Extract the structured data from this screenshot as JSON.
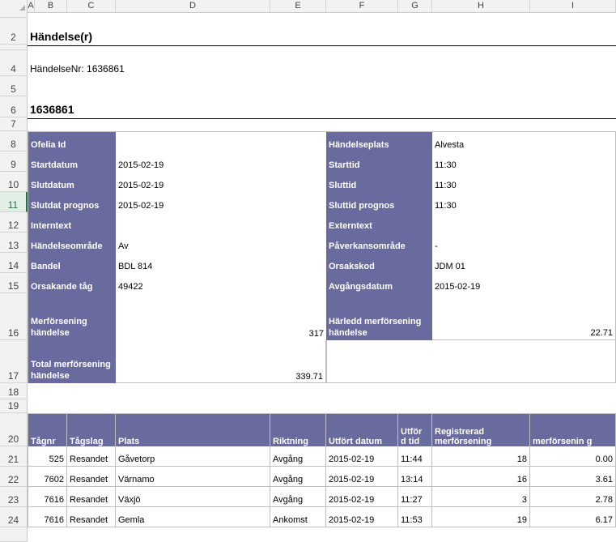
{
  "columns": [
    "B",
    "C",
    "D",
    "E",
    "F",
    "G",
    "H",
    "I"
  ],
  "rows": [
    "2",
    "4",
    "5",
    "6",
    "7",
    "8",
    "9",
    "10",
    "11",
    "12",
    "13",
    "14",
    "15",
    "16",
    "17",
    "18",
    "19",
    "20",
    "21",
    "22",
    "23",
    "24"
  ],
  "title": "Händelse(r)",
  "event_nr_line": "HändelseNr: 1636861",
  "event_id": "1636861",
  "fields_left": [
    {
      "label": "Ofelia Id",
      "value": ""
    },
    {
      "label": "Startdatum",
      "value": "2015-02-19"
    },
    {
      "label": "Slutdatum",
      "value": "2015-02-19"
    },
    {
      "label": "Slutdat prognos",
      "value": "2015-02-19"
    },
    {
      "label": "Interntext",
      "value": ""
    },
    {
      "label": "Händelseområde",
      "value": "Av"
    },
    {
      "label": "Bandel",
      "value": "BDL 814"
    },
    {
      "label": "Orsakande tåg",
      "value": "49422"
    }
  ],
  "fields_right": [
    {
      "label": "Händelseplats",
      "value": "Alvesta"
    },
    {
      "label": "Starttid",
      "value": "11:30"
    },
    {
      "label": "Sluttid",
      "value": "11:30"
    },
    {
      "label": "Sluttid prognos",
      "value": "11:30"
    },
    {
      "label": "Externtext",
      "value": ""
    },
    {
      "label": "Påverkansområde",
      "value": "-"
    },
    {
      "label": "Orsakskod",
      "value": "JDM 01"
    },
    {
      "label": "Avgångsdatum",
      "value": "2015-02-19"
    }
  ],
  "merforsening_label": "Merförsening händelse",
  "merforsening_value": "317",
  "harledd_label": "Härledd merförsening händelse",
  "harledd_value": "22.71",
  "total_label": "Total merförsening händelse",
  "total_value": "339.71",
  "table": {
    "headers": [
      "Tågnr",
      "Tågslag",
      "Plats",
      "Riktning",
      "Utfört datum",
      "Utför d tid",
      "Registrerad merförsening",
      "merförsenin g"
    ],
    "rows": [
      [
        "525",
        "Resandet",
        "Gåvetorp",
        "Avgång",
        "2015-02-19",
        "11:44",
        "18",
        "0.00"
      ],
      [
        "7602",
        "Resandet",
        "Värnamo",
        "Avgång",
        "2015-02-19",
        "13:14",
        "16",
        "3.61"
      ],
      [
        "7616",
        "Resandet",
        "Växjö",
        "Avgång",
        "2015-02-19",
        "11:27",
        "3",
        "2.78"
      ],
      [
        "7616",
        "Resandet",
        "Gemla",
        "Ankomst",
        "2015-02-19",
        "11:53",
        "19",
        "6.17"
      ]
    ]
  }
}
